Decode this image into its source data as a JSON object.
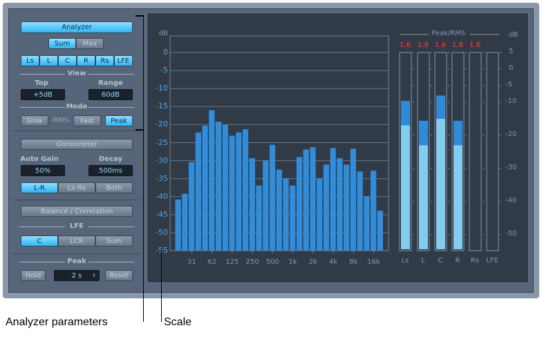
{
  "analyzer": {
    "title": "Analyzer",
    "sum": "Sum",
    "max": "Max",
    "channels": [
      "Ls",
      "L",
      "C",
      "R",
      "Rs",
      "LFE"
    ],
    "view_label": "View",
    "top_label": "Top",
    "top_value": "+5dB",
    "range_label": "Range",
    "range_value": "60dB",
    "mode_label": "Mode",
    "slow": "Slow",
    "rms": "-RMS-",
    "fast": "Fast",
    "peak": "Peak"
  },
  "goniometer": {
    "title": "Goniometer",
    "auto_gain_label": "Auto Gain",
    "auto_gain_value": "50%",
    "decay_label": "Decay",
    "decay_value": "500ms",
    "options": [
      "L-R",
      "Ls-Rs",
      "Both"
    ]
  },
  "balance": {
    "title": "Balance / Correlation"
  },
  "lfe": {
    "label": "LFE",
    "options": [
      "C",
      "LCR",
      "Sum"
    ]
  },
  "peak": {
    "label": "Peak",
    "hold": "Hold",
    "hold_time": "2 s",
    "reset": "Reset"
  },
  "spectrum": {
    "unit": "dB",
    "y_ticks": [
      "0",
      "-5",
      "-10",
      "-15",
      "-20",
      "-25",
      "-30",
      "-35",
      "-40",
      "-45",
      "-50",
      "-55"
    ],
    "x_ticks": [
      "31",
      "62",
      "125",
      "250",
      "500",
      "1k",
      "2k",
      "4k",
      "8k",
      "16k"
    ],
    "bars_db": [
      -40.8,
      -39.2,
      -30.4,
      -22.2,
      -20.3,
      -16,
      -19.2,
      -20.1,
      -23.1,
      -22.2,
      -21.3,
      -29.3,
      -36.9,
      -30,
      -25.6,
      -32.5,
      -34.9,
      -36.9,
      -29,
      -26.9,
      -26.3,
      -34.9,
      -31.1,
      -26.5,
      -29.3,
      -31.1,
      -26.7,
      -33,
      -39.9,
      -32.8,
      -43.9
    ],
    "bar_color": "#318dda"
  },
  "meters": {
    "title": "Peak/RMS",
    "unit": "dB",
    "scale": [
      "5",
      "0",
      "-5",
      "-10",
      "-20",
      "-30",
      "-40",
      "-50"
    ],
    "channels": [
      {
        "name": "Ls",
        "peak_readout": "1.6",
        "peak_db": -9.6,
        "rms_db": -17
      },
      {
        "name": "L",
        "peak_readout": "1.8",
        "peak_db": -15.6,
        "rms_db": -23
      },
      {
        "name": "C",
        "peak_readout": "1.6",
        "peak_db": -8,
        "rms_db": -15
      },
      {
        "name": "R",
        "peak_readout": "1.8",
        "peak_db": -15.6,
        "rms_db": -23
      },
      {
        "name": "Rs",
        "peak_readout": "1.6",
        "peak_db": null,
        "rms_db": null
      },
      {
        "name": "LFE",
        "peak_readout": "",
        "peak_db": null,
        "rms_db": null
      }
    ],
    "peak_color": "#2f8bd9",
    "rms_color": "#84cbf0"
  },
  "annotations": {
    "left": "Analyzer parameters",
    "right": "Scale"
  }
}
